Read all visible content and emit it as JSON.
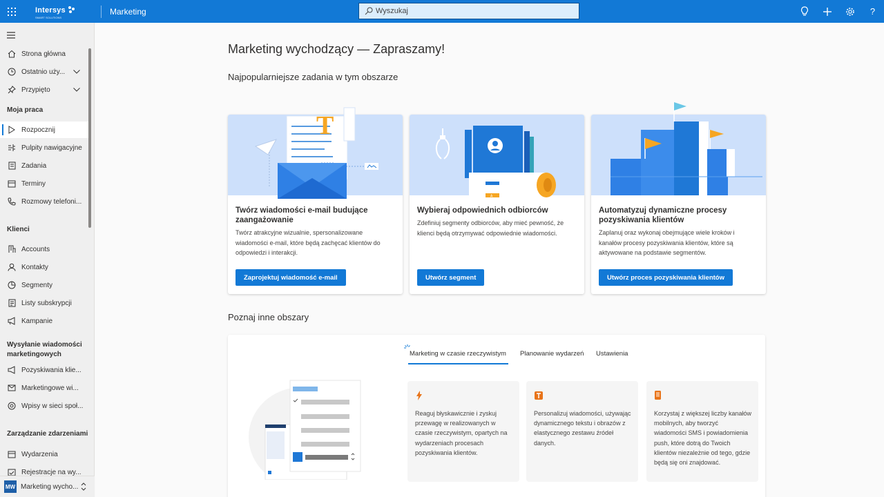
{
  "header": {
    "brand": "Intersys",
    "brand_sub": "SMART SOLUTIONS",
    "app_name": "Marketing",
    "search_placeholder": "Wyszukaj",
    "icons": [
      "lightbulb-icon",
      "plus-icon",
      "gear-icon",
      "help-icon"
    ]
  },
  "sidebar": {
    "top_items": [
      {
        "label": "Strona główna",
        "icon": "home-icon"
      },
      {
        "label": "Ostatnio uży...",
        "icon": "clock-icon"
      },
      {
        "label": "Przypięto",
        "icon": "pin-icon"
      }
    ],
    "groups": {
      "my_work": {
        "title": "Moja praca",
        "items": [
          {
            "label": "Rozpocznij",
            "icon": "play-icon"
          },
          {
            "label": "Pulpity nawigacyjne",
            "icon": "dashboard-icon"
          },
          {
            "label": "Zadania",
            "icon": "task-icon"
          },
          {
            "label": "Terminy",
            "icon": "calendar-icon"
          },
          {
            "label": "Rozmowy telefoni...",
            "icon": "phone-icon"
          }
        ]
      },
      "clients": {
        "title": "Klienci",
        "items": [
          {
            "label": "Accounts",
            "icon": "building-icon"
          },
          {
            "label": "Kontakty",
            "icon": "person-icon"
          },
          {
            "label": "Segmenty",
            "icon": "segment-icon"
          },
          {
            "label": "Listy subskrypcji",
            "icon": "list-icon"
          },
          {
            "label": "Kampanie",
            "icon": "megaphone-icon"
          }
        ]
      },
      "sending": {
        "title": "Wysyłanie wiadomości marketingowych",
        "items": [
          {
            "label": "Pozyskiwania klie...",
            "icon": "journey-icon"
          },
          {
            "label": "Marketingowe wi...",
            "icon": "mail-icon"
          },
          {
            "label": "Wpisy w sieci społ...",
            "icon": "social-icon"
          }
        ]
      },
      "events": {
        "title": "Zarządzanie zdarzeniami",
        "items": [
          {
            "label": "Wydarzenia",
            "icon": "calendar-icon"
          },
          {
            "label": "Rejestracje na wy...",
            "icon": "registration-icon"
          }
        ]
      }
    },
    "area": {
      "initials": "MW",
      "label": "Marketing wycho..."
    }
  },
  "main": {
    "title": "Marketing wychodzący — Zapraszamy!",
    "popular_title": "Najpopularniejsze zadania w tym obszarze",
    "cards": [
      {
        "title": "Twórz wiadomości e-mail budujące zaangażowanie",
        "desc": "Twórz atrakcyjne wizualnie, spersonalizowane wiadomości e-mail, które będą zachęcać klientów do odpowiedzi i interakcji.",
        "button": "Zaprojektuj wiadomość e-mail"
      },
      {
        "title": "Wybieraj odpowiednich odbiorców",
        "desc": "Zdefiniuj segmenty odbiorców, aby mieć pewność, że klienci będą otrzymywać odpowiednie wiadomości.",
        "button": "Utwórz segment"
      },
      {
        "title": "Automatyzuj dynamiczne procesy pozyskiwania klientów",
        "desc": "Zaplanuj oraz wykonaj obejmujące wiele kroków i kanałów procesy pozyskiwania klientów, które są aktywowane na podstawie segmentów.",
        "button": "Utwórz proces pozyskiwania klientów"
      }
    ],
    "explore_title": "Poznaj inne obszary",
    "tabs": [
      "Marketing w czasie rzeczywistym",
      "Planowanie wydarzeń",
      "Ustawienia"
    ],
    "features": [
      {
        "icon": "lightning-icon",
        "text": "Reaguj błyskawicznie i zyskuj przewagę w realizowanych w czasie rzeczywistym, opartych na wydarzeniach procesach pozyskiwania klientów."
      },
      {
        "icon": "text-icon",
        "text": "Personalizuj wiadomości, używając dynamicznego tekstu i obrazów z elastycznego zestawu źródeł danych."
      },
      {
        "icon": "mobile-icon",
        "text": "Korzystaj z większej liczby kanałów mobilnych, aby tworzyć wiadomości SMS i powiadomienia push, które dotrą do Twoich klientów niezależnie od tego, gdzie będą się oni znajdować."
      }
    ],
    "colors": {
      "accent": "#1279d6",
      "art_bg": "#cde0fb",
      "orange": "#e8741a"
    }
  }
}
